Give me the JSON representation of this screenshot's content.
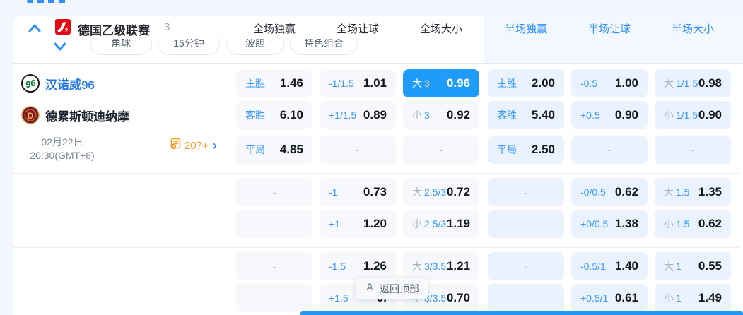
{
  "colors": {
    "accent_blue": "#1f9cf9",
    "label_blue": "#3898fb",
    "selected_line_gold": "#f6cb77",
    "orange": "#f59a23",
    "half_header_blue": "#2e90f8"
  },
  "league_header": {
    "name": "德国乙级联赛",
    "count": "3",
    "full_columns": [
      "全场独赢",
      "全场让球",
      "全场大小"
    ],
    "half_columns": [
      "半场独赢",
      "半场让球",
      "半场大小"
    ]
  },
  "filter_row": {
    "pills": [
      "角球",
      "15分钟",
      "波胆",
      "特色组合"
    ]
  },
  "match": {
    "home_team": "汉诺威96",
    "away_team": "德累斯顿迪纳摩",
    "date": "02月22日",
    "time": "20:30(GMT+8)",
    "more_markets_count": "207+"
  },
  "odds_groups": [
    {
      "rows": [
        {
          "cells": [
            {
              "label": "主胜",
              "value": "1.46"
            },
            {
              "label": "-1/1.5",
              "value": "1.01"
            },
            {
              "ou": "大",
              "line": "3",
              "value": "0.96",
              "selected": true
            },
            {
              "label": "主胜",
              "value": "2.00"
            },
            {
              "label": "-0.5",
              "value": "1.00"
            },
            {
              "ou": "大",
              "line": "1/1.5",
              "value": "0.98"
            }
          ]
        },
        {
          "cells": [
            {
              "label": "客胜",
              "value": "6.10"
            },
            {
              "label": "+1/1.5",
              "value": "0.89"
            },
            {
              "ou": "小",
              "line": "3",
              "value": "0.92"
            },
            {
              "label": "客胜",
              "value": "5.40"
            },
            {
              "label": "+0.5",
              "value": "0.90"
            },
            {
              "ou": "小",
              "line": "1/1.5",
              "value": "0.90"
            }
          ]
        },
        {
          "cells": [
            {
              "label": "平局",
              "value": "4.85"
            },
            {
              "empty": true
            },
            {
              "empty": true
            },
            {
              "label": "平局",
              "value": "2.50"
            },
            {
              "empty": true
            },
            {
              "empty": true
            }
          ]
        }
      ]
    },
    {
      "rows": [
        {
          "cells": [
            {
              "empty": true
            },
            {
              "label": "-1",
              "value": "0.73"
            },
            {
              "ou": "大",
              "line": "2.5/3",
              "value": "0.72"
            },
            {
              "empty": true
            },
            {
              "label": "-0/0.5",
              "value": "0.62"
            },
            {
              "ou": "大",
              "line": "1.5",
              "value": "1.35"
            }
          ]
        },
        {
          "cells": [
            {
              "empty": true
            },
            {
              "label": "+1",
              "value": "1.20"
            },
            {
              "ou": "小",
              "line": "2.5/3",
              "value": "1.19"
            },
            {
              "empty": true
            },
            {
              "label": "+0/0.5",
              "value": "1.38"
            },
            {
              "ou": "小",
              "line": "1.5",
              "value": "0.62"
            }
          ]
        }
      ]
    },
    {
      "rows": [
        {
          "cells": [
            {
              "empty": true
            },
            {
              "label": "-1.5",
              "value": "1.26"
            },
            {
              "ou": "大",
              "line": "3/3.5",
              "value": "1.21"
            },
            {
              "empty": true
            },
            {
              "label": "-0.5/1",
              "value": "1.40"
            },
            {
              "ou": "大",
              "line": "1",
              "value": "0.55"
            }
          ]
        },
        {
          "cells": [
            {
              "empty": true
            },
            {
              "label": "+1.5",
              "value": "0."
            },
            {
              "ou": "小",
              "line": "3/3.5",
              "value": "0.70"
            },
            {
              "empty": true
            },
            {
              "label": "+0.5/1",
              "value": "0.61"
            },
            {
              "ou": "小",
              "line": "1",
              "value": "1.49"
            }
          ]
        }
      ]
    }
  ],
  "back_to_top": {
    "label": "返回顶部"
  }
}
